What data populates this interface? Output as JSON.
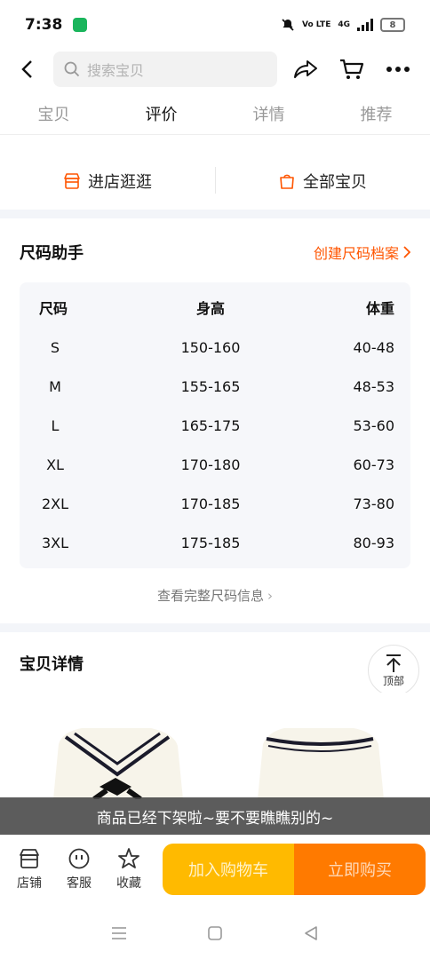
{
  "status_bar": {
    "time": "7:38",
    "network": "4G",
    "volte": "Vo LTE",
    "battery": "8"
  },
  "search": {
    "placeholder": "搜索宝贝"
  },
  "tabs": [
    {
      "label": "宝贝",
      "active": false
    },
    {
      "label": "评价",
      "active": true
    },
    {
      "label": "详情",
      "active": false
    },
    {
      "label": "推荐",
      "active": false
    }
  ],
  "shop_buttons": {
    "visit_store": "进店逛逛",
    "all_items": "全部宝贝"
  },
  "size_helper": {
    "title": "尺码助手",
    "create_link": "创建尺码档案",
    "headers": [
      "尺码",
      "身高",
      "体重"
    ],
    "rows": [
      {
        "size": "S",
        "height": "150-160",
        "weight": "40-48"
      },
      {
        "size": "M",
        "height": "155-165",
        "weight": "48-53"
      },
      {
        "size": "L",
        "height": "165-175",
        "weight": "53-60"
      },
      {
        "size": "XL",
        "height": "170-180",
        "weight": "60-73"
      },
      {
        "size": "2XL",
        "height": "170-185",
        "weight": "73-80"
      },
      {
        "size": "3XL",
        "height": "175-185",
        "weight": "80-93"
      }
    ],
    "full_info_link": "查看完整尺码信息"
  },
  "detail": {
    "title": "宝贝详情",
    "back_to_top": "顶部"
  },
  "toast": "商品已经下架啦~要不要瞧瞧别的~",
  "action_bar": {
    "store": "店铺",
    "service": "客服",
    "favorite": "收藏",
    "add_to_cart": "加入购物车",
    "buy_now": "立即购买"
  },
  "colors": {
    "accent": "#ff5500",
    "cart": "#ffba00",
    "buy": "#ff7a00"
  }
}
